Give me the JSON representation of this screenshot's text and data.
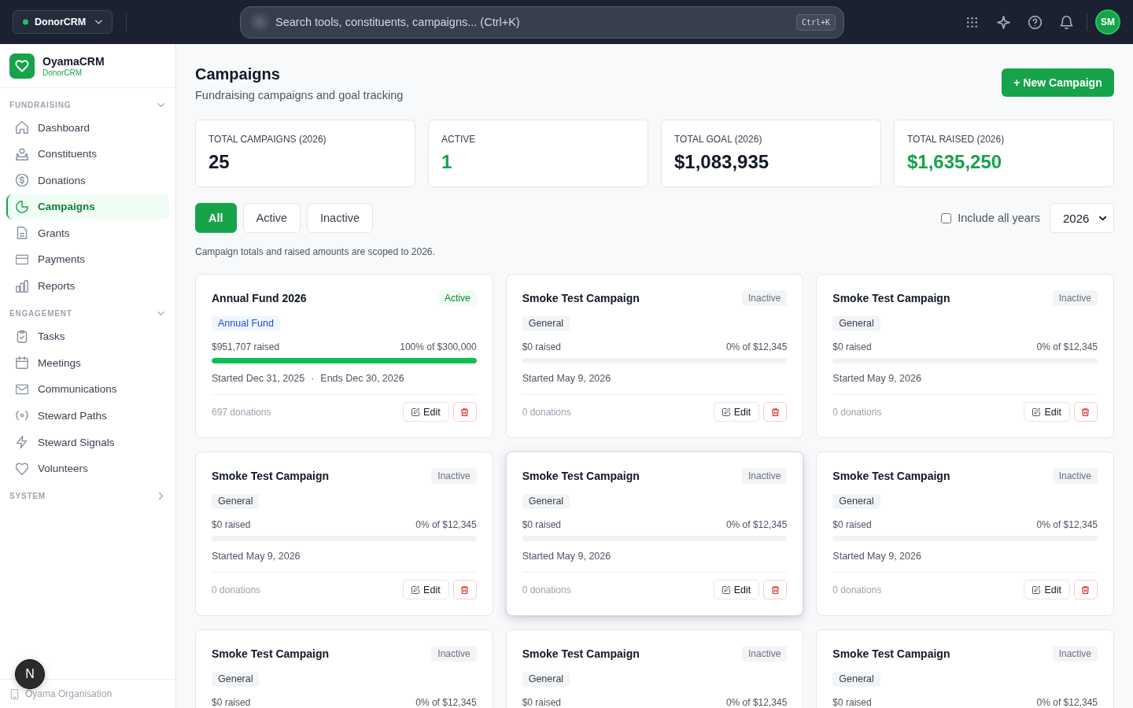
{
  "topbar": {
    "workspace": "DonorCRM",
    "search": {
      "placeholder": "Search tools, constituents, campaigns... (Ctrl+K)",
      "shortcut": "Ctrl+K"
    },
    "avatar": "SM"
  },
  "sidebar": {
    "brand": {
      "name": "OyamaCRM",
      "product": "DonorCRM"
    },
    "sections": [
      {
        "title": "FUNDRAISING",
        "expanded": true,
        "items": [
          {
            "label": "Dashboard",
            "selected": false
          },
          {
            "label": "Constituents",
            "selected": false
          },
          {
            "label": "Donations",
            "selected": false
          },
          {
            "label": "Campaigns",
            "selected": true
          },
          {
            "label": "Grants",
            "selected": false
          },
          {
            "label": "Payments",
            "selected": false
          },
          {
            "label": "Reports",
            "selected": false
          }
        ]
      },
      {
        "title": "ENGAGEMENT",
        "expanded": true,
        "items": [
          {
            "label": "Tasks",
            "selected": false
          },
          {
            "label": "Meetings",
            "selected": false
          },
          {
            "label": "Communications",
            "selected": false
          },
          {
            "label": "Steward Paths",
            "selected": false
          },
          {
            "label": "Steward Signals",
            "selected": false
          },
          {
            "label": "Volunteers",
            "selected": false
          }
        ]
      },
      {
        "title": "SYSTEM",
        "expanded": false
      }
    ],
    "organisation": "Oyama Organisation"
  },
  "dev_badge": "N",
  "page": {
    "title": "Campaigns",
    "subtitle": "Fundraising campaigns and goal tracking",
    "new_button": "+ New Campaign"
  },
  "stats": [
    {
      "label": "TOTAL CAMPAIGNS (2026)",
      "value": "25",
      "accent": false
    },
    {
      "label": "ACTIVE",
      "value": "1",
      "accent": true
    },
    {
      "label": "TOTAL GOAL (2026)",
      "value": "$1,083,935",
      "accent": false
    },
    {
      "label": "TOTAL RAISED (2026)",
      "value": "$1,635,250",
      "accent": true
    }
  ],
  "filters": [
    {
      "label": "All",
      "selected": true
    },
    {
      "label": "Active",
      "selected": false
    },
    {
      "label": "Inactive",
      "selected": false
    }
  ],
  "include_all_years": {
    "label": "Include all years",
    "checked": false
  },
  "year_select": {
    "value": "2026"
  },
  "scope_note": "Campaign totals and raised amounts are scoped to 2026.",
  "campaigns": [
    {
      "title": "Annual Fund 2026",
      "status": "Active",
      "active": true,
      "tag": {
        "label": "Annual Fund",
        "kind": "fund"
      },
      "raised": "$951,707 raised",
      "goal": "100% of $300,000",
      "level": 1,
      "dates": [
        "Started Dec 31, 2025",
        "Ends Dec 30, 2026"
      ],
      "separator": "·",
      "donations": "697 donations",
      "edit": "Edit",
      "hovered": false
    },
    {
      "title": "Smoke Test Campaign",
      "status": "Inactive",
      "active": false,
      "tag": {
        "label": "General",
        "kind": "general"
      },
      "raised": "$0 raised",
      "goal": "0% of $12,345",
      "level": 0,
      "dates": [
        "Started May 9, 2026"
      ],
      "donations": "0 donations",
      "edit": "Edit",
      "hovered": false
    },
    {
      "title": "Smoke Test Campaign",
      "status": "Inactive",
      "active": false,
      "tag": {
        "label": "General",
        "kind": "general"
      },
      "raised": "$0 raised",
      "goal": "0% of $12,345",
      "level": 0,
      "dates": [
        "Started May 9, 2026"
      ],
      "donations": "0 donations",
      "edit": "Edit",
      "hovered": false
    },
    {
      "title": "Smoke Test Campaign",
      "status": "Inactive",
      "active": false,
      "tag": {
        "label": "General",
        "kind": "general"
      },
      "raised": "$0 raised",
      "goal": "0% of $12,345",
      "level": 0,
      "dates": [
        "Started May 9, 2026"
      ],
      "donations": "0 donations",
      "edit": "Edit",
      "hovered": false
    },
    {
      "title": "Smoke Test Campaign",
      "status": "Inactive",
      "active": false,
      "tag": {
        "label": "General",
        "kind": "general"
      },
      "raised": "$0 raised",
      "goal": "0% of $12,345",
      "level": 0,
      "dates": [
        "Started May 9, 2026"
      ],
      "donations": "0 donations",
      "edit": "Edit",
      "hovered": true
    },
    {
      "title": "Smoke Test Campaign",
      "status": "Inactive",
      "active": false,
      "tag": {
        "label": "General",
        "kind": "general"
      },
      "raised": "$0 raised",
      "goal": "0% of $12,345",
      "level": 0,
      "dates": [
        "Started May 9, 2026"
      ],
      "donations": "0 donations",
      "edit": "Edit",
      "hovered": false
    },
    {
      "title": "Smoke Test Campaign",
      "status": "Inactive",
      "active": false,
      "tag": {
        "label": "General",
        "kind": "general"
      },
      "raised": "$0 raised",
      "goal": "0% of $12,345",
      "hovered": false
    },
    {
      "title": "Smoke Test Campaign",
      "status": "Inactive",
      "active": false,
      "tag": {
        "label": "General",
        "kind": "general"
      },
      "raised": "$0 raised",
      "goal": "0% of $12,345",
      "hovered": false
    },
    {
      "title": "Smoke Test Campaign",
      "status": "Inactive",
      "active": false,
      "tag": {
        "label": "General",
        "kind": "general"
      },
      "raised": "$0 raised",
      "goal": "0% of $12,345",
      "hovered": false
    }
  ]
}
